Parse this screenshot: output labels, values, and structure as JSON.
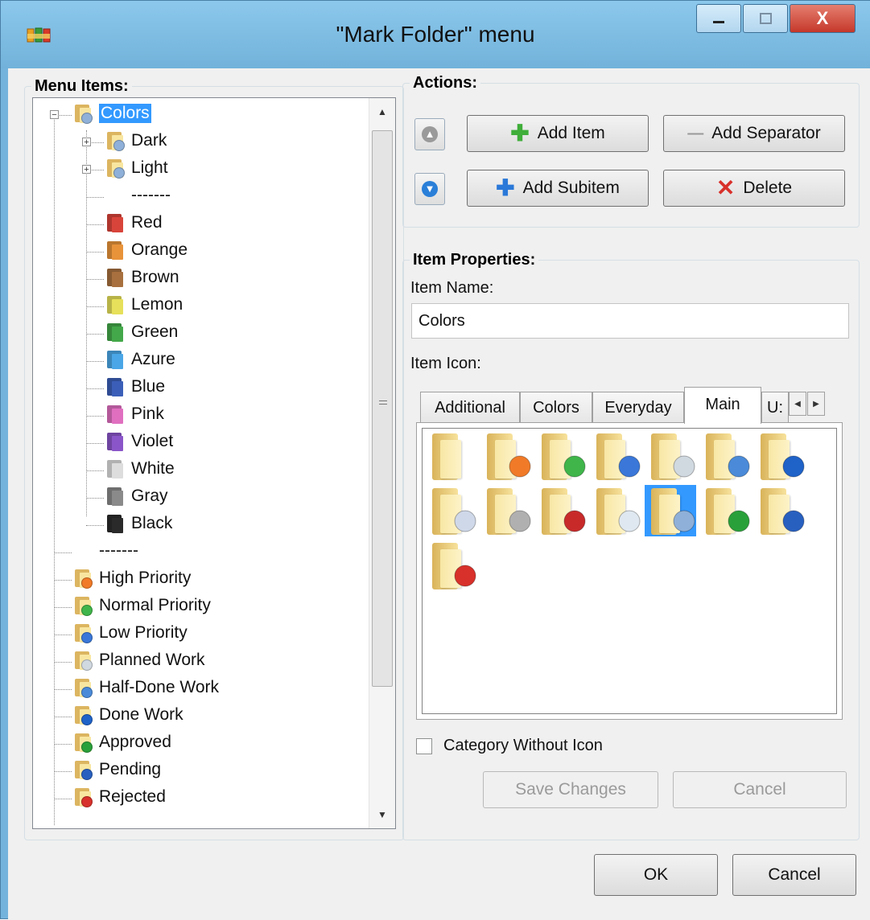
{
  "window": {
    "title": "\"Mark Folder\" menu",
    "close_glyph": "X"
  },
  "menu_items": {
    "title": "Menu Items:",
    "tree": [
      {
        "label": "Colors",
        "level": 0,
        "expander": "−",
        "selected": true,
        "icon": "folder-colors-icon",
        "badge": "#8fb0d8"
      },
      {
        "label": "Dark",
        "level": 1,
        "expander": "+",
        "icon": "folder-colors-icon",
        "badge": "#8fb0d8"
      },
      {
        "label": "Light",
        "level": 1,
        "expander": "+",
        "icon": "folder-colors-icon",
        "badge": "#8fb0d8"
      },
      {
        "label": "-------",
        "level": 1,
        "separator": true
      },
      {
        "label": "Red",
        "level": 1,
        "color": "#d9443a"
      },
      {
        "label": "Orange",
        "level": 1,
        "color": "#e8933a"
      },
      {
        "label": "Brown",
        "level": 1,
        "color": "#a8703e"
      },
      {
        "label": "Lemon",
        "level": 1,
        "color": "#e6e05a"
      },
      {
        "label": "Green",
        "level": 1,
        "color": "#43a84a"
      },
      {
        "label": "Azure",
        "level": 1,
        "color": "#4aa6e6"
      },
      {
        "label": "Blue",
        "level": 1,
        "color": "#3b5fb8"
      },
      {
        "label": "Pink",
        "level": 1,
        "color": "#e06fc0"
      },
      {
        "label": "Violet",
        "level": 1,
        "color": "#8a55c8"
      },
      {
        "label": "White",
        "level": 1,
        "color": "#dddddd"
      },
      {
        "label": "Gray",
        "level": 1,
        "color": "#8a8a8a"
      },
      {
        "label": "Black",
        "level": 1,
        "color": "#2a2a2a"
      },
      {
        "label": "-------",
        "level": 0,
        "separator": true
      },
      {
        "label": "High Priority",
        "level": 0,
        "icon": "folder-arrow-up-icon",
        "badge": "#f07a28"
      },
      {
        "label": "Normal Priority",
        "level": 0,
        "icon": "folder-arrows-updown-icon",
        "badge": "#3fb54a"
      },
      {
        "label": "Low Priority",
        "level": 0,
        "icon": "folder-arrow-down-icon",
        "badge": "#3a77d8"
      },
      {
        "label": "Planned Work",
        "level": 0,
        "icon": "folder-planned-icon",
        "badge": "#d0d8e0"
      },
      {
        "label": "Half-Done Work",
        "level": 0,
        "icon": "folder-half-icon",
        "badge": "#4a8ad8"
      },
      {
        "label": "Done Work",
        "level": 0,
        "icon": "folder-done-icon",
        "badge": "#1f62c8"
      },
      {
        "label": "Approved",
        "level": 0,
        "icon": "folder-approved-icon",
        "badge": "#2aa03a"
      },
      {
        "label": "Pending",
        "level": 0,
        "icon": "folder-pending-icon",
        "badge": "#2860c0"
      },
      {
        "label": "Rejected",
        "level": 0,
        "icon": "folder-rejected-icon",
        "badge": "#d8302a"
      }
    ]
  },
  "actions": {
    "title": "Actions:",
    "add_item": "Add Item",
    "add_separator": "Add Separator",
    "add_subitem": "Add Subitem",
    "delete": "Delete"
  },
  "properties": {
    "title": "Item Properties:",
    "item_name_label": "Item Name:",
    "item_name_value": "Colors",
    "item_icon_label": "Item Icon:",
    "tabs": [
      "Additional",
      "Colors",
      "Everyday",
      "Main",
      "U:"
    ],
    "active_tab": "Main",
    "icons": [
      {
        "name": "folder-plain-icon"
      },
      {
        "name": "folder-arrow-up-icon",
        "color": "#f07a28"
      },
      {
        "name": "folder-arrows-updown-icon",
        "color": "#3fb54a"
      },
      {
        "name": "folder-arrow-down-icon",
        "color": "#3a77d8"
      },
      {
        "name": "folder-planned-icon",
        "color": "#d0d8e0"
      },
      {
        "name": "folder-half-icon",
        "color": "#4a8ad8"
      },
      {
        "name": "folder-done-icon",
        "color": "#1f62c8"
      },
      {
        "name": "folder-document-icon",
        "color": "#cfd8e8"
      },
      {
        "name": "folder-lock-icon",
        "color": "#b0b0b0"
      },
      {
        "name": "folder-warning-icon",
        "color": "#c82a2a"
      },
      {
        "name": "folder-clock-icon",
        "color": "#dfe8f0"
      },
      {
        "name": "folder-colors-icon",
        "color": "#8fb0d8",
        "selected": true
      },
      {
        "name": "folder-approved-icon",
        "color": "#2aa03a"
      },
      {
        "name": "folder-pending-icon",
        "color": "#2860c0"
      },
      {
        "name": "folder-rejected-icon",
        "color": "#d8302a"
      }
    ],
    "category_without_icon": "Category Without Icon",
    "save_changes": "Save Changes",
    "cancel": "Cancel"
  },
  "footer": {
    "ok": "OK",
    "cancel": "Cancel"
  }
}
